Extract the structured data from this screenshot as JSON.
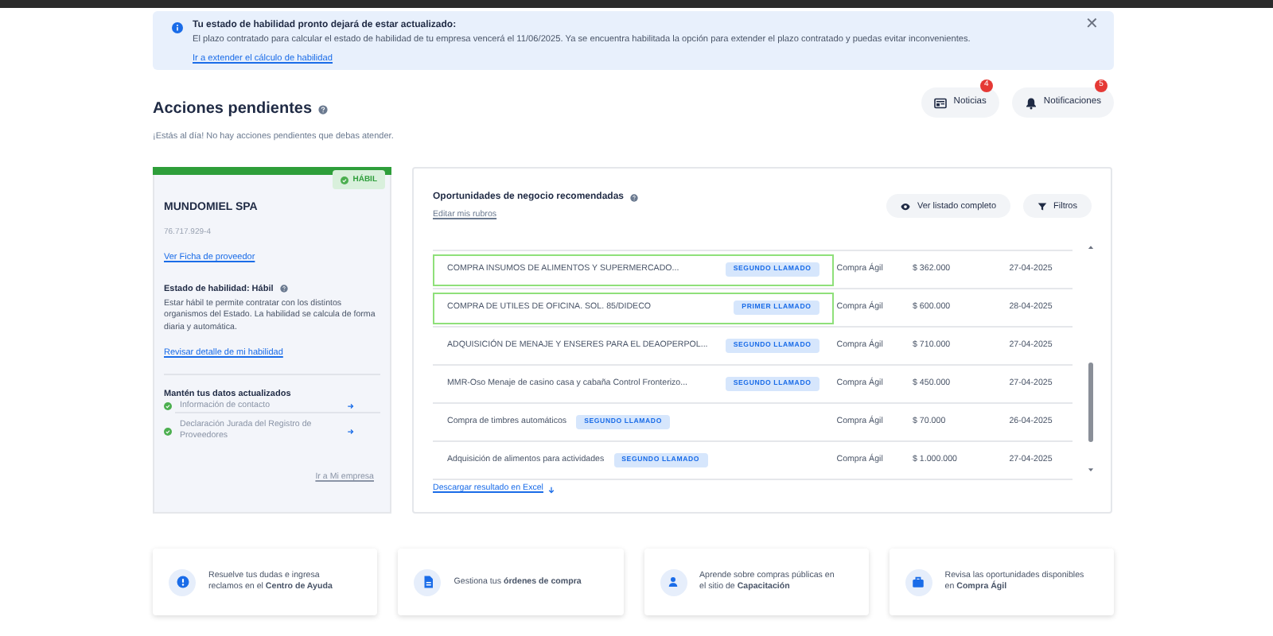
{
  "alert": {
    "title": "Tu estado de habilidad pronto dejará de estar actualizado:",
    "message": "El plazo contratado para calcular el estado de habilidad de tu empresa vencerá el 11/06/2025. Ya se encuentra habilitada la opción para extender el plazo contratado y puedas evitar inconvenientes.",
    "link": "Ir a extender el cálculo de habilidad",
    "close": "✕"
  },
  "header": {
    "title": "Acciones pendientes",
    "subtitle": "¡Estás al día! No hay acciones pendientes que debas atender.",
    "buttons": [
      {
        "kind": "news",
        "label": "Noticias",
        "count": "4"
      },
      {
        "kind": "bell",
        "label": "Notificaciones",
        "count": "5"
      }
    ]
  },
  "supplier": {
    "status_badge": "HÁBIL",
    "name": "MUNDOMIEL SPA",
    "rut": "76.717.929-4",
    "profile_link": "Ver Ficha de proveedor",
    "status_title": "Estado de habilidad: Hábil",
    "status_text": "Estar hábil te permite contratar con los distintos organismos del Estado. La habilidad se calcula de forma diaria y automática.",
    "detail_link": "Revisar detalle de mi habilidad",
    "update_title": "Mantén tus datos actualizados",
    "update_items": [
      {
        "label": "Información de contacto",
        "done": true
      },
      {
        "label": "Declaración Jurada del Registro de Proveedores",
        "done": true
      }
    ],
    "company_link": "Ir a Mi empresa"
  },
  "opportunities": {
    "title": "Oportunidades de negocio recomendadas",
    "edit_link": "Editar mis rubros",
    "buttons": [
      {
        "kind": "eye",
        "label": "Ver listado completo"
      },
      {
        "kind": "filter",
        "label": "Filtros"
      }
    ],
    "rows": [
      {
        "name": "COMPRA INSUMOS DE ALIMENTOS Y SUPERMERCADO...",
        "call": "SEGUNDO LLAMADO",
        "type": "Compra Ágil",
        "amount": "$ 362.000",
        "date": "27-04-2025",
        "highlighted": true
      },
      {
        "name": "COMPRA DE UTILES DE OFICINA. SOL. 85/DIDECO",
        "call": "PRIMER LLAMADO",
        "type": "Compra Ágil",
        "amount": "$ 600.000",
        "date": "28-04-2025",
        "highlighted": true
      },
      {
        "name": "ADQUISICIÓN DE MENAJE Y ENSERES PARA EL DEAOPERPOL...",
        "call": "SEGUNDO LLAMADO",
        "type": "Compra Ágil",
        "amount": "$ 710.000",
        "date": "27-04-2025",
        "highlighted": false
      },
      {
        "name": "MMR-Oso Menaje de casino casa y cabaña Control Fronterizo...",
        "call": "SEGUNDO LLAMADO",
        "type": "Compra Ágil",
        "amount": "$ 450.000",
        "date": "27-04-2025",
        "highlighted": false
      },
      {
        "name": "Compra de timbres automáticos",
        "call": "SEGUNDO LLAMADO",
        "type": "Compra Ágil",
        "amount": "$ 70.000",
        "date": "26-04-2025",
        "highlighted": false
      },
      {
        "name": "Adquisición de alimentos para actividades",
        "call": "SEGUNDO LLAMADO",
        "type": "Compra Ágil",
        "amount": "$ 1.000.000",
        "date": "27-04-2025",
        "highlighted": false
      }
    ],
    "download_link": "Descargar resultado en Excel"
  },
  "help_cards": [
    {
      "kind": "help",
      "text": "Resuelve tus dudas e ingresa reclamos en el **Centro de Ayuda**"
    },
    {
      "kind": "doc",
      "text": "Gestiona tus **órdenes de compra**"
    },
    {
      "kind": "person",
      "text": "Aprende sobre compras públicas en el sitio de **Capacitación**"
    },
    {
      "kind": "bag",
      "text": "Revisa las oportunidades disponibles en **Compra Ágil**"
    }
  ]
}
